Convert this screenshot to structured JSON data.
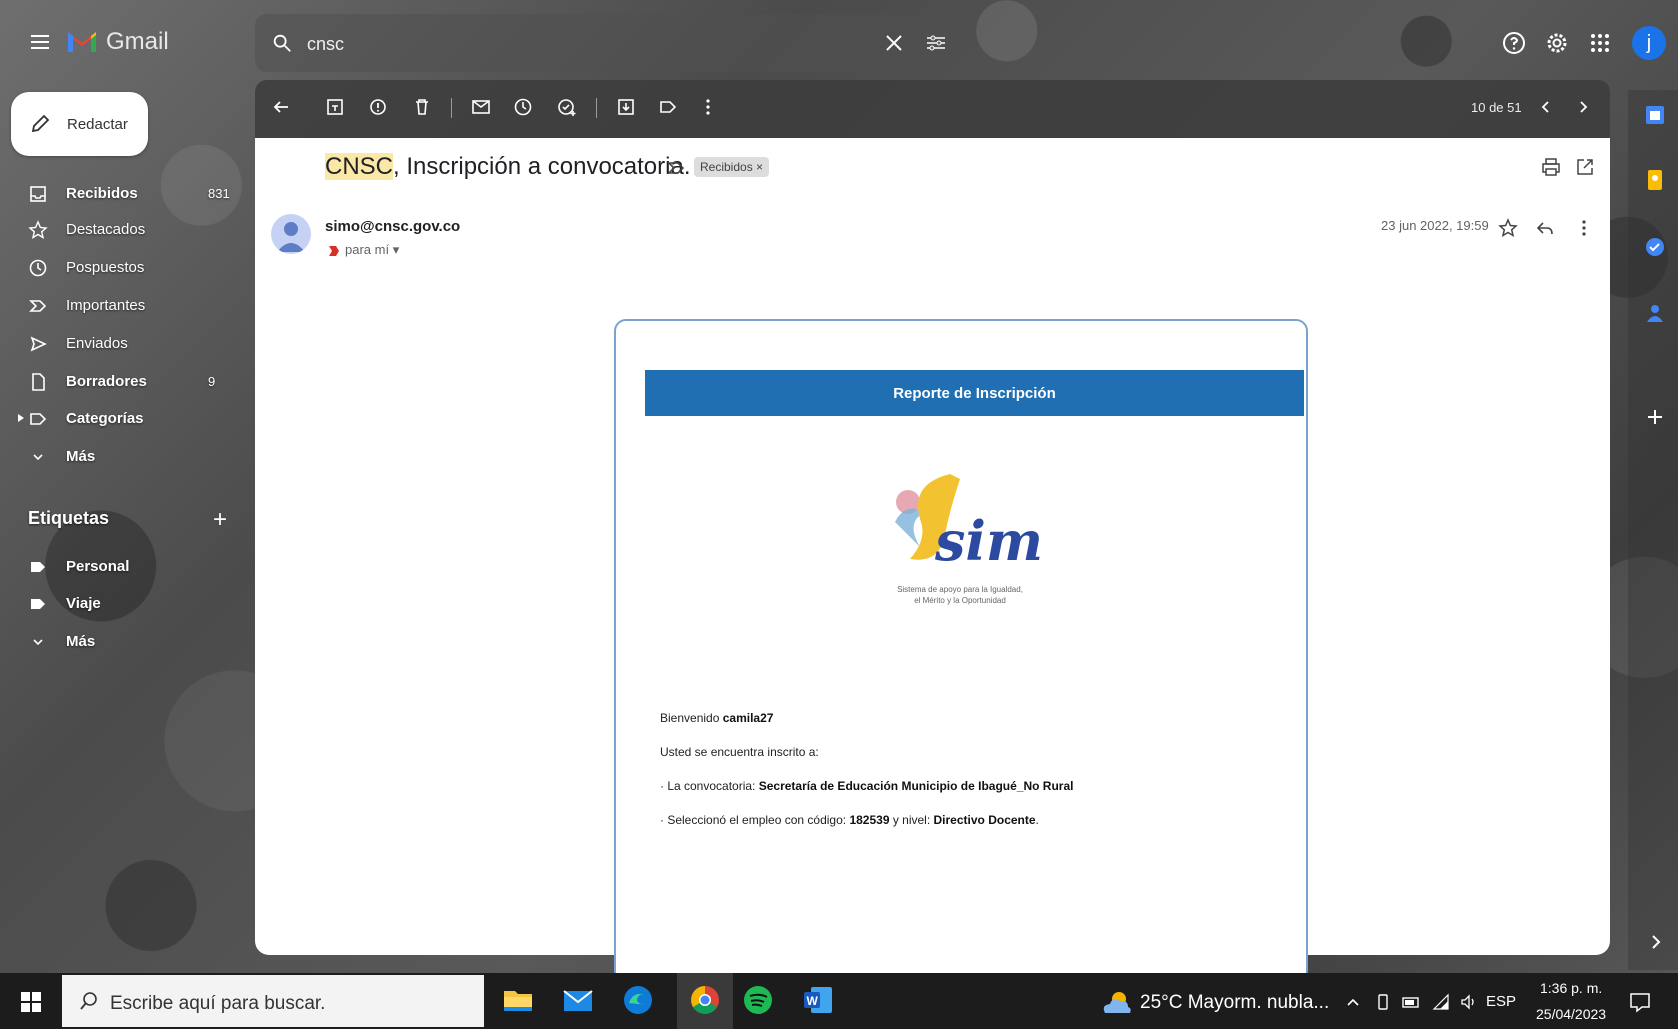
{
  "app": {
    "name": "Gmail"
  },
  "search": {
    "value": "cnsc"
  },
  "compose": {
    "label": "Redactar"
  },
  "nav": [
    {
      "label": "Recibidos",
      "count": "831"
    },
    {
      "label": "Destacados"
    },
    {
      "label": "Pospuestos"
    },
    {
      "label": "Importantes"
    },
    {
      "label": "Enviados"
    },
    {
      "label": "Borradores",
      "count": "9"
    },
    {
      "label": "Categorías"
    },
    {
      "label": "Más"
    }
  ],
  "labels": {
    "title": "Etiquetas",
    "items": [
      {
        "label": "Personal"
      },
      {
        "label": "Viaje"
      },
      {
        "label": "Más"
      }
    ]
  },
  "toolbar": {
    "count": "10 de 51"
  },
  "message": {
    "subject_highlight": "CNSC",
    "subject_rest": ", Inscripción a convocatoria.",
    "label_chip": "Recibidos ×",
    "sender": "simo@cnsc.gov.co",
    "to": "para mí",
    "date": "23 jun 2022, 19:59"
  },
  "email_body": {
    "header": "Reporte de Inscripción",
    "logo_text": "simo",
    "logo_tagline_1": "Sistema de apoyo para la Igualdad,",
    "logo_tagline_2": "el Mérito y la Oportunidad",
    "welcome_prefix": "Bienvenido ",
    "username": "camila27",
    "line2": "Usted se encuentra inscrito a:",
    "line3_prefix": "· La convocatoria: ",
    "convocatoria": "Secretaría de Educación Municipio de Ibagué_No Rural",
    "line4_prefix": "· Seleccionó el empleo con código: ",
    "codigo": "182539",
    "line4_mid": " y nivel: ",
    "nivel": "Directivo Docente",
    "line4_end": "."
  },
  "taskbar": {
    "search_placeholder": "Escribe aquí para buscar.",
    "weather": "25°C  Mayorm. nubla...",
    "lang": "ESP",
    "time": "1:36 p. m.",
    "date": "25/04/2023"
  },
  "colors": {
    "report_bar": "#1f6fb2",
    "highlight": "#fce8a6",
    "avatar": "#1a73e8"
  }
}
